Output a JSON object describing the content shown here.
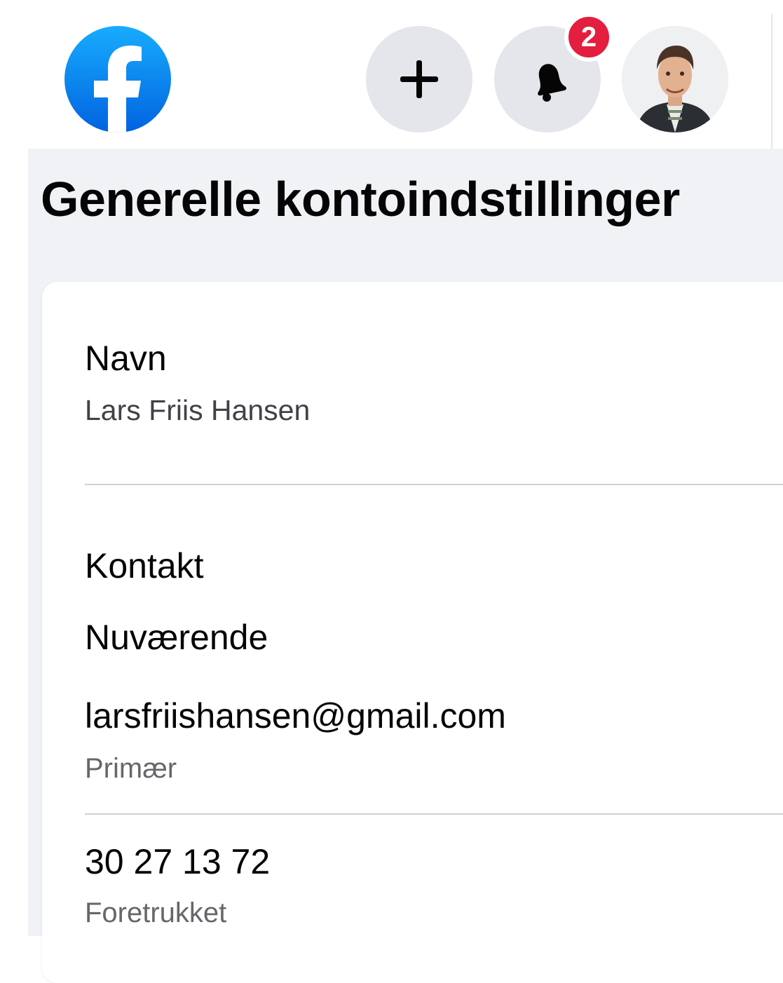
{
  "header": {
    "logo_icon": "facebook-logo-icon",
    "create_icon": "plus-icon",
    "notifications_icon": "bell-icon",
    "notification_count": "2",
    "avatar_icon": "profile-avatar",
    "brand_color": "#1877f2",
    "badge_color": "#e41e3f"
  },
  "page": {
    "title": "Generelle kontoindstillinger"
  },
  "name_section": {
    "label": "Navn",
    "value": "Lars Friis Hansen"
  },
  "contact_section": {
    "label": "Kontakt",
    "subheading": "Nuværende",
    "email": {
      "value": "larsfriishansen@gmail.com",
      "tag": "Primær"
    },
    "phone": {
      "value": "30 27 13 72",
      "tag": "Foretrukket"
    }
  }
}
